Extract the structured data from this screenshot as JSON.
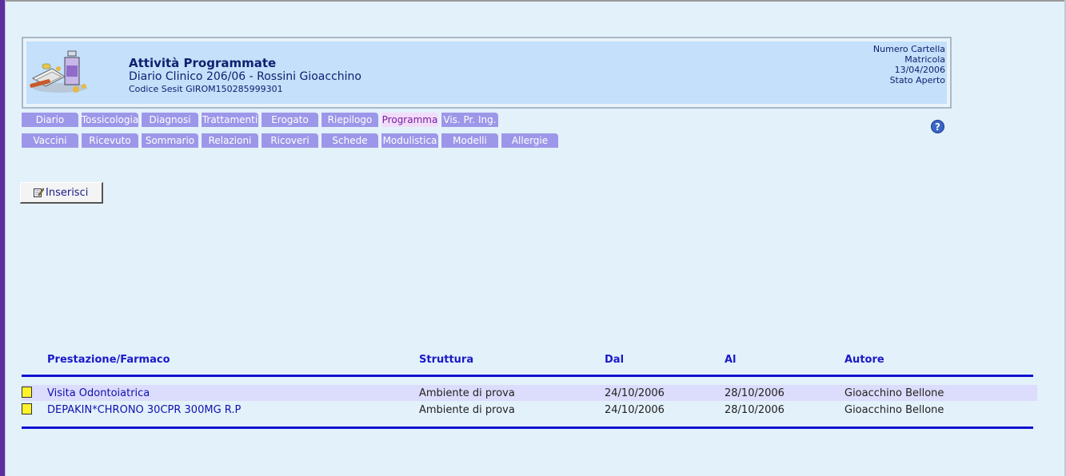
{
  "header": {
    "title": "Attività Programmate",
    "subtitle": "Diario Clinico 206/06 - Rossini Gioacchino",
    "code": "Codice Sesit GIROM150285999301",
    "info": [
      "Numero Cartella",
      "Matricola",
      "13/04/2006",
      "Stato Aperto"
    ]
  },
  "tabs_row1": [
    "Diario",
    "Tossicologia",
    "Diagnosi",
    "Trattamenti",
    "Erogato",
    "Riepilogo",
    "Programma",
    "Vis. Pr. Ing."
  ],
  "tabs_row2": [
    "Vaccini",
    "Ricevuto",
    "Sommario",
    "Relazioni",
    "Ricoveri",
    "Schede",
    "Modulistica",
    "Modelli",
    "Allergie"
  ],
  "active_tab": "Programma",
  "toolbar": {
    "insert_label": "Inserisci",
    "help_icon": "?"
  },
  "table": {
    "columns": [
      "Prestazione/Farmaco",
      "Struttura",
      "Dal",
      "Al",
      "Autore"
    ],
    "rows": [
      [
        "Visita Odontoiatrica",
        "Ambiente di prova",
        "24/10/2006",
        "28/10/2006",
        "Gioacchino Bellone"
      ],
      [
        "DEPAKIN*CHRONO 30CPR 300MG R.P",
        "Ambiente di prova",
        "24/10/2006",
        "28/10/2006",
        "Gioacchino Bellone"
      ]
    ]
  },
  "colors": {
    "page_bg": "#e3f1fb",
    "header_bg": "#c4e0fa",
    "tab_bg": "#9d97e9",
    "tab_active_bg": "#f2dcfa",
    "table_header_text": "#1a1ac8",
    "marker": "#fff22b"
  },
  "icons": {
    "logo": "medicine-bottle-pills-icon",
    "help": "help-icon",
    "insert": "edit-note-icon"
  }
}
